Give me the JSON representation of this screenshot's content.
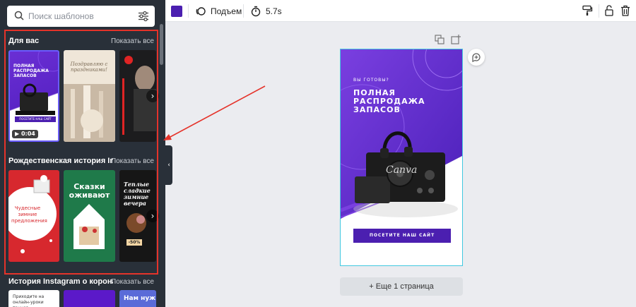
{
  "search": {
    "placeholder": "Поиск шаблонов"
  },
  "sections": [
    {
      "title": "Для вас",
      "link": "Показать все"
    },
    {
      "title": "Рождественская история Ins...",
      "link": "Показать все"
    },
    {
      "title": "История Instagram о корона...",
      "link": "Показать все"
    }
  ],
  "templates": {
    "t1": {
      "pre": "ВЫ ГОТОВЫ?",
      "headline": "ПОЛНАЯ РАСПРОДАЖА ЗАПАСОВ",
      "button": "ПОСЕТИТЕ НАШ САЙТ",
      "duration": "0:04"
    },
    "t2": {
      "text": "Поздравляю с праздниками!"
    },
    "t4": {
      "text": "Чудесные зимние предложения"
    },
    "t5": {
      "text": "Сказки оживают"
    },
    "t6": {
      "text": "Теплые сладкие зимние вечера",
      "badge": "-50%"
    },
    "t7": {
      "text": "Приходите на онлайн-уроки танцев"
    },
    "t9": {
      "text": "Нам нуж"
    }
  },
  "toolbar": {
    "color": "#4b1fb0",
    "animation_label": "Подъем",
    "duration_label": "5.7s"
  },
  "design": {
    "pre": "ВЫ ГОТОВЫ?",
    "headline": "ПОЛНАЯ РАСПРОДАЖА ЗАПАСОВ",
    "cta": "ПОСЕТИТЕ НАШ САЙТ",
    "watermark": "Canva",
    "accent": "#6a2fd4"
  },
  "add_page_label": "+ Еще 1 страница",
  "colors": {
    "panel": "#293039",
    "highlight": "#e5332a",
    "canvas_border": "#41c8e0"
  }
}
